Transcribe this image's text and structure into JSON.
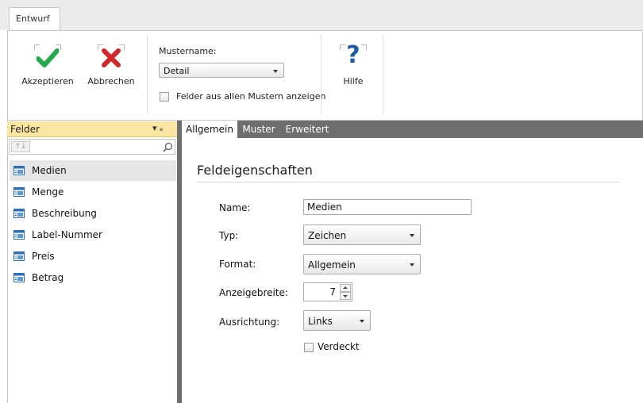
{
  "ribbon": {
    "tab": "Entwurf",
    "accept_label": "Akzeptieren",
    "cancel_label": "Abbrechen",
    "pattern_name_label": "Mustername:",
    "pattern_name_value": "Detail",
    "all_patterns_checkbox_label": "Felder aus allen Mustern anzeigen",
    "help_label": "Hilfe",
    "help_glyph": "?"
  },
  "fields_panel": {
    "title": "Felder",
    "pin_glyph": "▾ ₑ",
    "sort_glyph": "↑↓",
    "search_value": "",
    "items": [
      {
        "label": "Medien",
        "selected": true
      },
      {
        "label": "Menge"
      },
      {
        "label": "Beschreibung"
      },
      {
        "label": "Label-Nummer"
      },
      {
        "label": "Preis"
      },
      {
        "label": "Betrag"
      }
    ]
  },
  "properties": {
    "tabs": [
      "Allgemein",
      "Muster",
      "Erweitert"
    ],
    "active_tab": "Allgemein",
    "section_title": "Feldeigenschaften",
    "name_label": "Name:",
    "name_value": "Medien",
    "type_label": "Typ:",
    "type_value": "Zeichen",
    "format_label": "Format:",
    "format_value": "Allgemein",
    "width_label": "Anzeigebreite:",
    "width_value": "7",
    "alignment_label": "Ausrichtung:",
    "alignment_value": "Links",
    "hidden_label": "Verdeckt"
  },
  "colors": {
    "accept_green": "#23a84a",
    "cancel_red": "#d02828",
    "help_blue": "#1f5aa6",
    "panel_header": "#fbe5a3",
    "tab_bar": "#6e6e6e"
  }
}
